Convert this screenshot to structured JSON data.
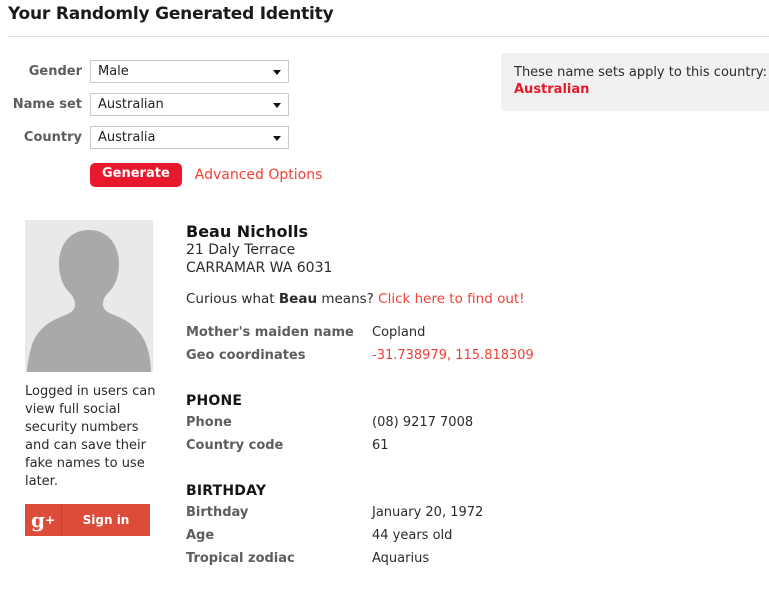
{
  "header": {
    "title": "Your Randomly Generated Identity"
  },
  "form": {
    "fields": [
      {
        "label": "Gender",
        "value": "Male",
        "name": "gender"
      },
      {
        "label": "Name set",
        "value": "Australian",
        "name": "nameset"
      },
      {
        "label": "Country",
        "value": "Australia",
        "name": "country"
      }
    ],
    "generate_label": "Generate",
    "advanced_label": "Advanced Options"
  },
  "nameset_panel": {
    "applies_text": "These name sets apply to this country:",
    "nameset": "Australian"
  },
  "sidebar": {
    "avatar_alt": "default-avatar-silhouette",
    "note": "Logged in users can view full social security numbers and can save their fake names to use later.",
    "signin_icon": "google-plus-icon",
    "signin_label": "Sign in"
  },
  "identity": {
    "name": "Beau Nicholls",
    "first_name": "Beau",
    "address_line1": "21 Daly Terrace",
    "address_line2": "CARRAMAR WA 6031",
    "meaning_prefix": "Curious what ",
    "meaning_suffix": " means? ",
    "meaning_link": "Click here to find out!",
    "basic_rows": [
      {
        "key": "Mother's maiden name",
        "value": "Copland",
        "accent": false
      },
      {
        "key": "Geo coordinates",
        "value": "-31.738979, 115.818309",
        "accent": true
      }
    ]
  },
  "sections": [
    {
      "heading": "PHONE",
      "rows": [
        {
          "key": "Phone",
          "value": "(08) 9217 7008"
        },
        {
          "key": "Country code",
          "value": "61"
        }
      ]
    },
    {
      "heading": "BIRTHDAY",
      "rows": [
        {
          "key": "Birthday",
          "value": "January 20, 1972"
        },
        {
          "key": "Age",
          "value": "44 years old"
        },
        {
          "key": "Tropical zodiac",
          "value": "Aquarius"
        }
      ]
    }
  ],
  "colors": {
    "brand_red": "#e8192c",
    "link_red": "#ef4136",
    "google_red": "#dd4b39",
    "panel_gray": "#f1f1f1",
    "label_gray": "#5d5d5d"
  }
}
